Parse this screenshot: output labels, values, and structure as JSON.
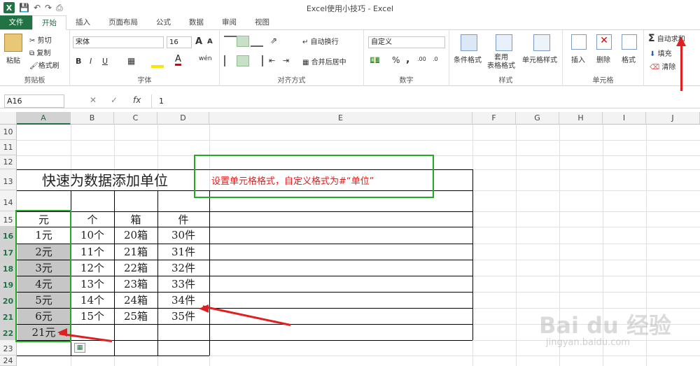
{
  "window_title": "Excel使用小技巧 - Excel",
  "tabs": [
    "文件",
    "开始",
    "插入",
    "页面布局",
    "公式",
    "数据",
    "审阅",
    "视图"
  ],
  "clipboard": {
    "paste": "粘贴",
    "cut": "剪切",
    "copy": "复制",
    "painter": "格式刷",
    "label": "剪贴板"
  },
  "font": {
    "name": "宋体",
    "size": "16",
    "bold": "B",
    "italic": "I",
    "underline": "U",
    "label": "字体",
    "wen": "wén",
    "bigA": "A",
    "smallA": "A"
  },
  "align": {
    "wrap": "自动换行",
    "merge": "合并后居中",
    "label": "对齐方式"
  },
  "number": {
    "format": "自定义",
    "percent": "%",
    "comma": ",",
    "label": "数字"
  },
  "styles": {
    "cond": "条件格式",
    "table": "套用\n表格格式",
    "cell": "单元格样式",
    "label": "样式"
  },
  "cells": {
    "insert": "插入",
    "delete": "删除",
    "format": "格式",
    "label": "单元格"
  },
  "editing": {
    "autosum": "自动求和",
    "fill": "填充",
    "clear": "清除"
  },
  "formula_bar": {
    "name_box": "A16",
    "value": "1",
    "fx": "fx"
  },
  "columns": [
    "A",
    "B",
    "C",
    "D",
    "E",
    "F",
    "G",
    "H",
    "I",
    "J"
  ],
  "rows": [
    "10",
    "11",
    "12",
    "13",
    "14",
    "15",
    "16",
    "17",
    "18",
    "19",
    "20",
    "21",
    "22",
    "23",
    "24"
  ],
  "sheet": {
    "title": "快速为数据添加单位",
    "note": "设置单元格格式，自定义格式为#“单位”",
    "headers": [
      "元",
      "个",
      "箱",
      "件"
    ],
    "data": [
      [
        "1元",
        "10个",
        "20箱",
        "30件"
      ],
      [
        "2元",
        "11个",
        "21箱",
        "31件"
      ],
      [
        "3元",
        "12个",
        "22箱",
        "32件"
      ],
      [
        "4元",
        "13个",
        "23箱",
        "33件"
      ],
      [
        "5元",
        "14个",
        "24箱",
        "34件"
      ],
      [
        "6元",
        "15个",
        "25箱",
        "35件"
      ]
    ],
    "sum": "21元"
  },
  "watermark": {
    "logo": "Bai du 经验",
    "url": "jingyan.baidu.com"
  },
  "colors": {
    "accent": "#217346",
    "highlight": "#22aa22",
    "arrow": "#e02020"
  }
}
